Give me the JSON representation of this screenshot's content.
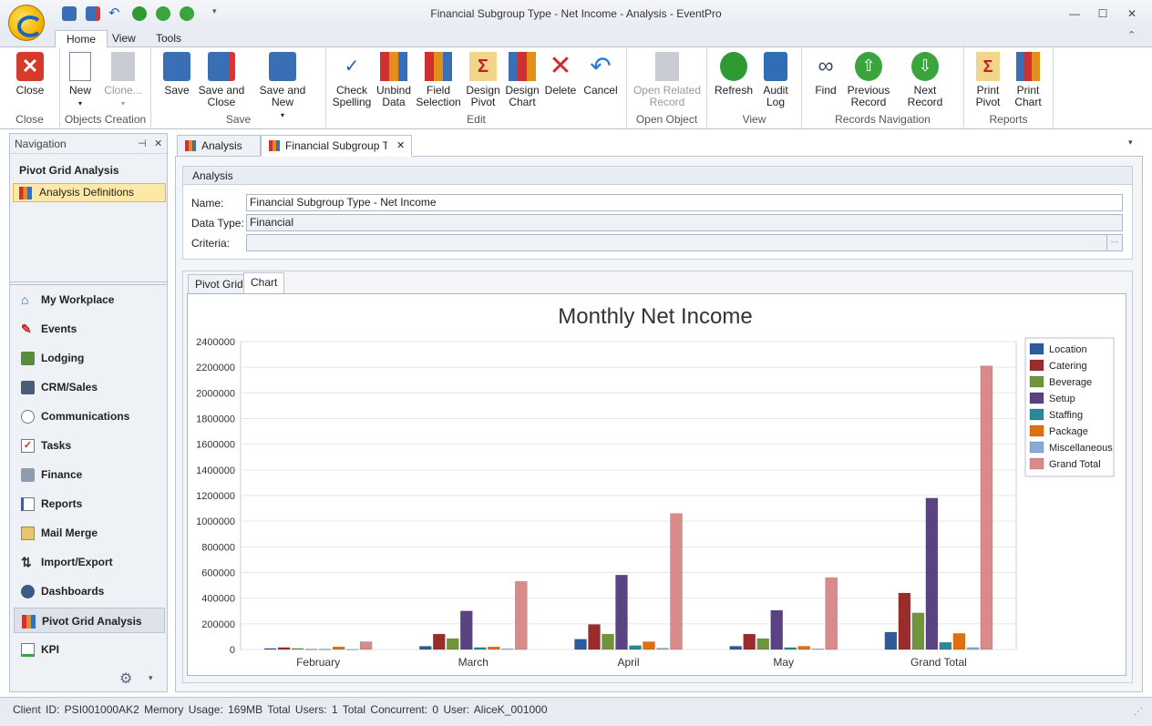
{
  "window": {
    "title": "Financial Subgroup Type - Net Income - Analysis - EventPro",
    "minimize": "—",
    "maximize": "☐",
    "close": "✕"
  },
  "ribbon_tabs": [
    "Home",
    "View",
    "Tools"
  ],
  "ribbon": {
    "groups": {
      "close": "Close",
      "objects": "Objects Creation",
      "save": "Save",
      "edit": "Edit",
      "open": "Open Object",
      "view": "View",
      "records": "Records Navigation",
      "reports": "Reports"
    },
    "buttons": {
      "close": "Close",
      "new": "New",
      "clone": "Clone...",
      "save": "Save",
      "save_close": "Save and\nClose",
      "save_new": "Save and New",
      "check_spelling": "Check\nSpelling",
      "unbind": "Unbind\nData",
      "field_selection": "Field\nSelection",
      "design_pivot": "Design\nPivot",
      "design_chart": "Design\nChart",
      "delete": "Delete",
      "cancel": "Cancel",
      "open_related": "Open Related\nRecord",
      "refresh": "Refresh",
      "audit_log": "Audit\nLog",
      "find": "Find",
      "previous": "Previous\nRecord",
      "next": "Next Record",
      "print_pivot": "Print\nPivot",
      "print_chart": "Print\nChart"
    }
  },
  "navigation": {
    "header": "Navigation",
    "pin": "⊣",
    "close": "✕",
    "section_title": "Pivot Grid Analysis",
    "selected_item": "Analysis Definitions",
    "items": [
      "My Workplace",
      "Events",
      "Lodging",
      "CRM/Sales",
      "Communications",
      "Tasks",
      "Finance",
      "Reports",
      "Mail Merge",
      "Import/Export",
      "Dashboards",
      "Pivot Grid Analysis",
      "KPI"
    ],
    "active_item": "Pivot Grid Analysis"
  },
  "doc_tabs": [
    "Analysis",
    "Financial Subgroup Type"
  ],
  "analysis": {
    "panel_title": "Analysis",
    "name_label": "Name:",
    "name_value": "Financial Subgroup Type - Net Income",
    "datatype_label": "Data Type:",
    "datatype_value": "Financial",
    "criteria_label": "Criteria:",
    "criteria_value": "",
    "criteria_button": "···"
  },
  "chart_tabs": [
    "Pivot Grid",
    "Chart"
  ],
  "chart_data": {
    "type": "bar",
    "title": "Monthly Net Income",
    "categories": [
      "February",
      "March",
      "April",
      "May",
      "Grand Total"
    ],
    "ylim": [
      0,
      2400000
    ],
    "yticks": [
      0,
      200000,
      400000,
      600000,
      800000,
      1000000,
      1200000,
      1400000,
      1600000,
      1800000,
      2000000,
      2200000,
      2400000
    ],
    "legend_position": "right",
    "grid": true,
    "series": [
      {
        "name": "Location",
        "color": "#2e5b9a",
        "values": [
          8000,
          25000,
          80000,
          25000,
          135000
        ]
      },
      {
        "name": "Catering",
        "color": "#9b2c2c",
        "values": [
          15000,
          120000,
          195000,
          120000,
          440000
        ]
      },
      {
        "name": "Beverage",
        "color": "#6f963d",
        "values": [
          8000,
          85000,
          120000,
          85000,
          285000
        ]
      },
      {
        "name": "Setup",
        "color": "#5b4282",
        "values": [
          2000,
          300000,
          580000,
          305000,
          1180000
        ]
      },
      {
        "name": "Staffing",
        "color": "#2c8798",
        "values": [
          2000,
          15000,
          30000,
          15000,
          55000
        ]
      },
      {
        "name": "Package",
        "color": "#e0700f",
        "values": [
          20000,
          20000,
          60000,
          25000,
          125000
        ]
      },
      {
        "name": "Miscellaneous",
        "color": "#8aa9d6",
        "values": [
          1000,
          5000,
          10000,
          5000,
          15000
        ]
      },
      {
        "name": "Grand Total",
        "color": "#d98a8a",
        "values": [
          60000,
          530000,
          1060000,
          560000,
          2210000
        ]
      }
    ]
  },
  "status": {
    "text": "Client ID: PSI001000AK2   Memory Usage: 169MB   Total Users: 1   Total Concurrent: 0   User: AliceK_001000"
  }
}
